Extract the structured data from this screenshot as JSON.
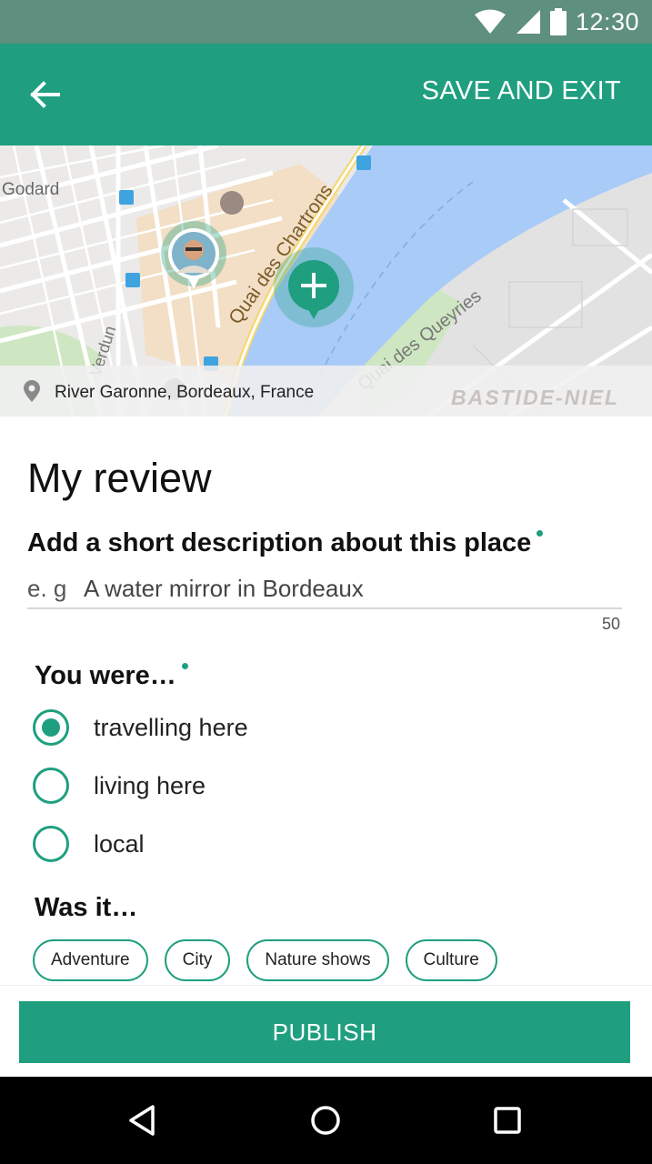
{
  "status_bar": {
    "time": "12:30",
    "icons": [
      "wifi-icon",
      "signal-icon",
      "battery-icon"
    ]
  },
  "app_bar": {
    "back_icon": "arrow-left-icon",
    "action_label": "SAVE AND EXIT"
  },
  "map": {
    "address": "River Garonne, Bordeaux, France",
    "district": "BASTIDE-NIEL",
    "street_labels": {
      "godard": "Godard",
      "quai_chartrons": "Quai des Chartrons",
      "quai_queyries": "Quai des Queyries",
      "verdun": "Verdun"
    },
    "add_marker_icon": "plus-icon"
  },
  "review": {
    "title": "My review",
    "description_label": "Add a short description about this place",
    "description_prefix": "e. g",
    "description_placeholder": "A water mirror in Bordeaux",
    "char_limit": "50",
    "you_were_label": "You were…",
    "options": [
      {
        "label": "travelling here",
        "selected": true
      },
      {
        "label": "living here",
        "selected": false
      },
      {
        "label": "local",
        "selected": false
      }
    ],
    "was_it_label": "Was it…",
    "tags": [
      "Adventure",
      "City",
      "Nature shows",
      "Culture"
    ]
  },
  "publish_label": "PUBLISH",
  "colors": {
    "accent": "#1f9f7f",
    "status_bar": "#5f8f7e",
    "nav_bar": "#000000"
  }
}
